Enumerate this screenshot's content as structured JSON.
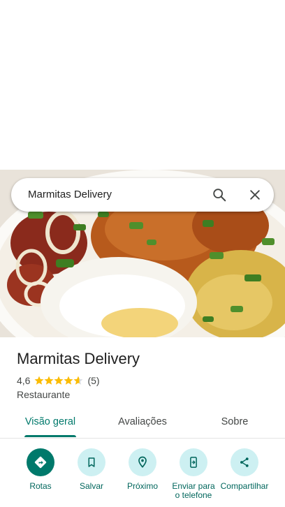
{
  "search": {
    "query": "Marmitas Delivery",
    "search_icon": "search-icon",
    "close_icon": "close-icon"
  },
  "place": {
    "name": "Marmitas Delivery",
    "rating": "4,6",
    "star_rating": 4.6,
    "review_count": "(5)",
    "category": "Restaurante"
  },
  "tabs": [
    {
      "label": "Visão geral",
      "active": true
    },
    {
      "label": "Avaliações",
      "active": false
    },
    {
      "label": "Sobre",
      "active": false
    }
  ],
  "actions": [
    {
      "label": "Rotas",
      "icon": "directions-icon"
    },
    {
      "label": "Salvar",
      "icon": "bookmark-icon"
    },
    {
      "label": "Próximo",
      "icon": "nearby-icon"
    },
    {
      "label": "Enviar para o telefone",
      "icon": "send-to-phone-icon"
    },
    {
      "label": "Compartilhar",
      "icon": "share-icon"
    }
  ],
  "colors": {
    "accent": "#00796b",
    "star": "#fbbc04",
    "action_bg": "#cdf0f2"
  }
}
